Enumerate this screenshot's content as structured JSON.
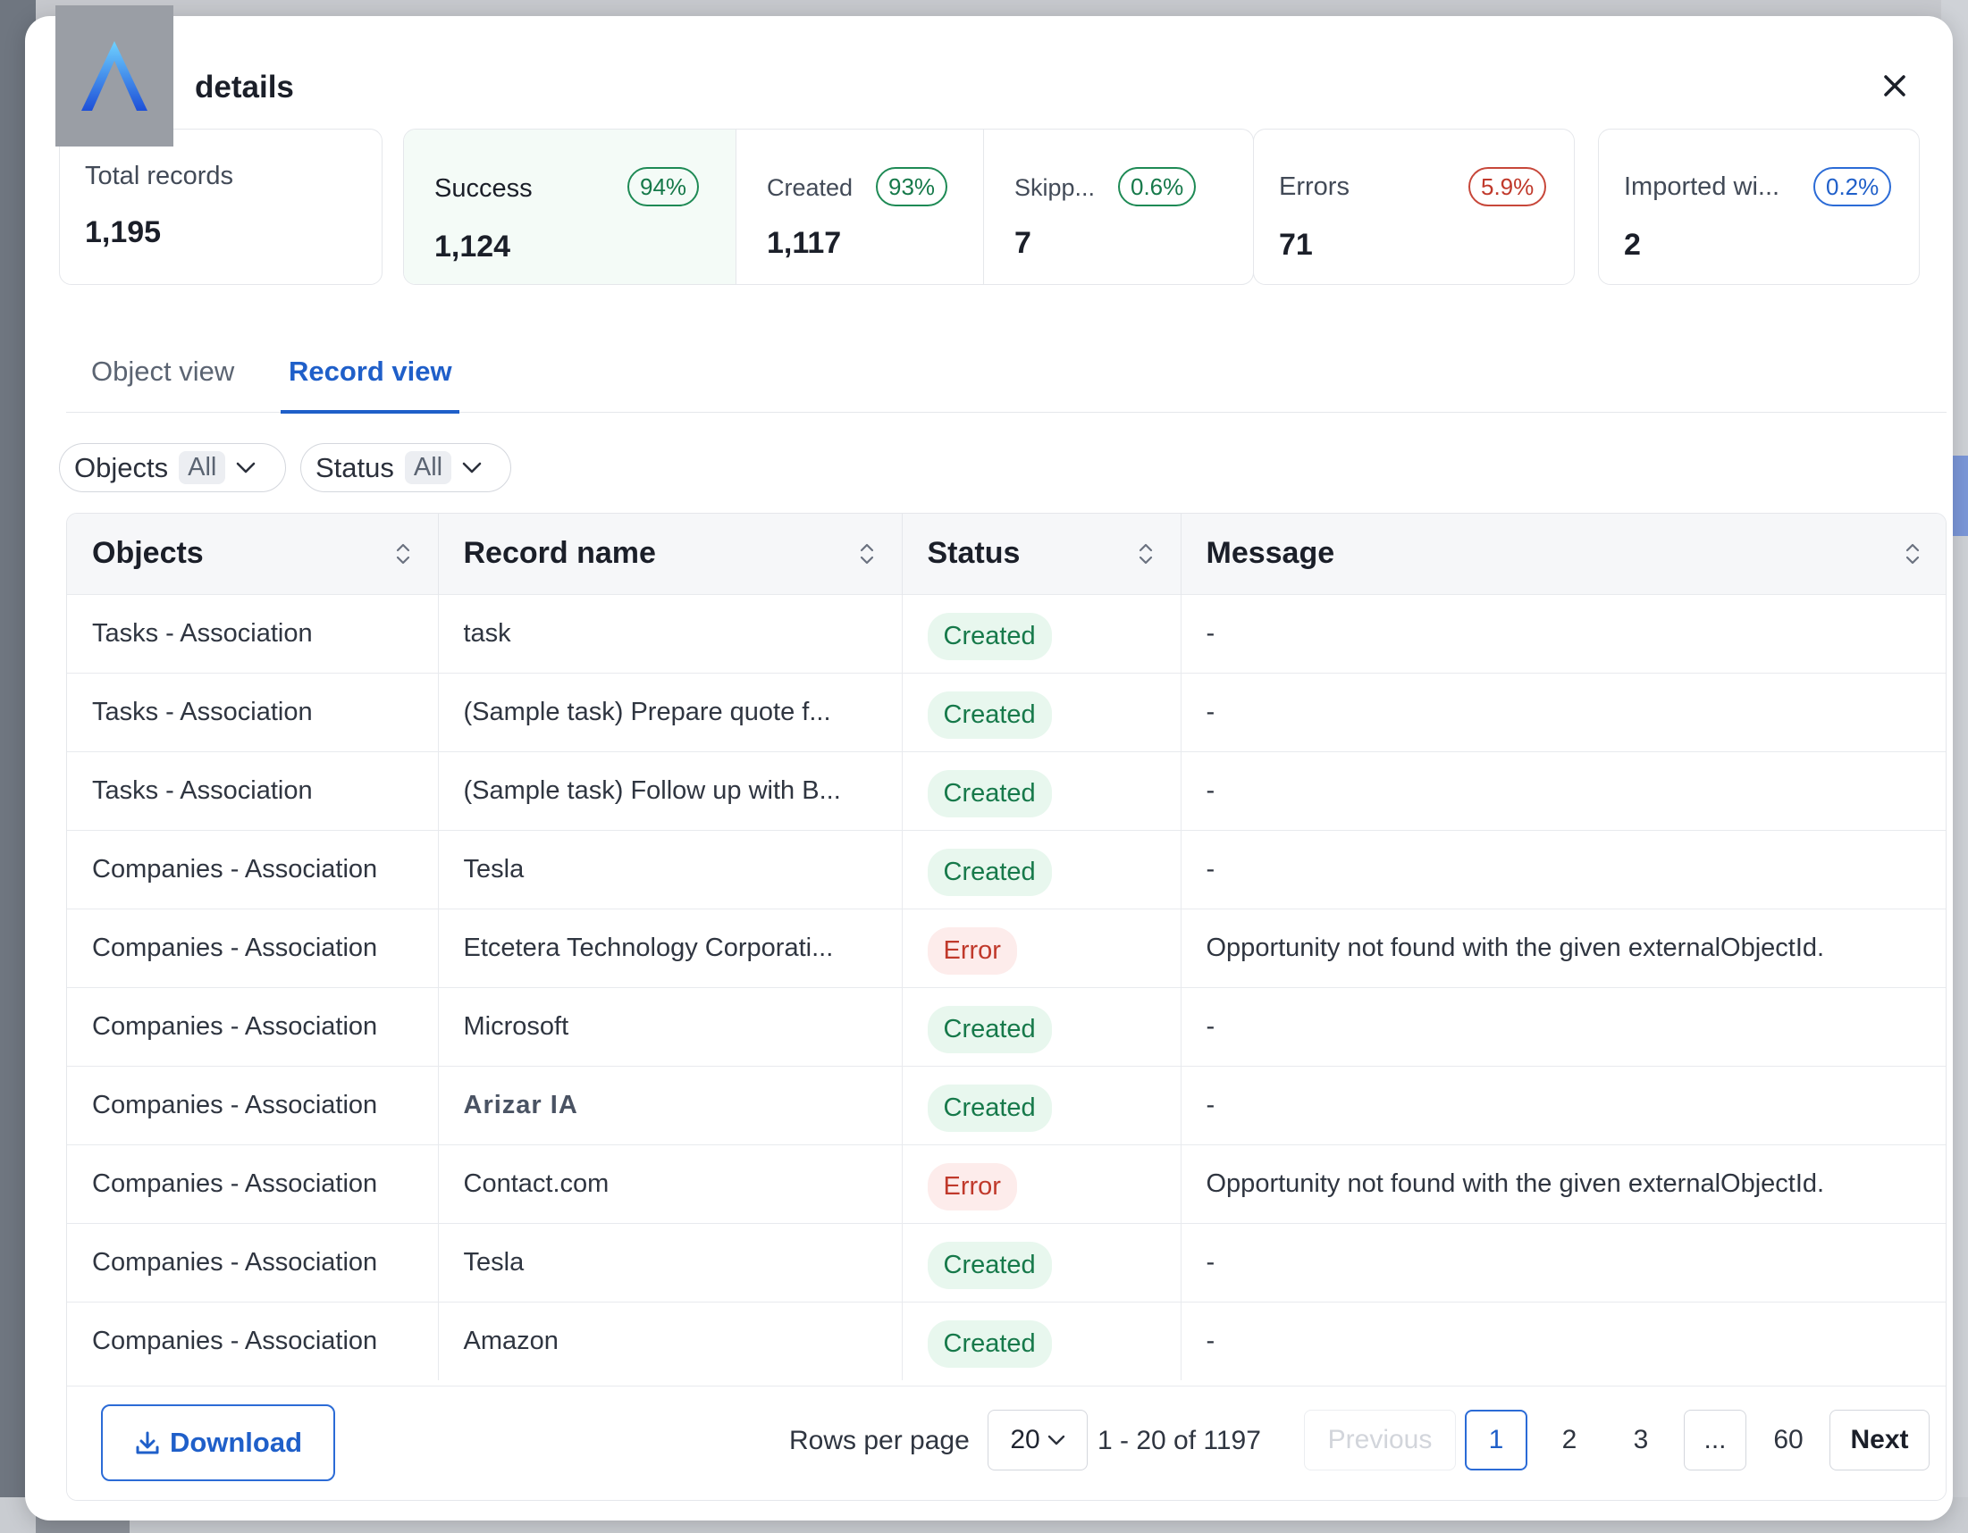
{
  "modal": {
    "title": "details"
  },
  "stats": {
    "total": {
      "label": "Total records",
      "value": "1,195"
    },
    "success": {
      "label": "Success",
      "pct": "94%",
      "value": "1,124"
    },
    "created": {
      "label": "Created",
      "pct": "93%",
      "value": "1,117"
    },
    "skipped": {
      "label": "Skipp...",
      "pct": "0.6%",
      "value": "7"
    },
    "errors": {
      "label": "Errors",
      "pct": "5.9%",
      "value": "71"
    },
    "imported": {
      "label": "Imported wi...",
      "pct": "0.2%",
      "value": "2"
    }
  },
  "tabs": [
    {
      "label": "Object view"
    },
    {
      "label": "Record view"
    }
  ],
  "filters": [
    {
      "label": "Objects",
      "value": "All"
    },
    {
      "label": "Status",
      "value": "All"
    }
  ],
  "table": {
    "headers": [
      "Objects",
      "Record name",
      "Status",
      "Message"
    ],
    "rows": [
      {
        "object": "Tasks - Association",
        "name": "task",
        "status": "Created",
        "message": "-"
      },
      {
        "object": "Tasks - Association",
        "name": "(Sample task) Prepare quote f...",
        "status": "Created",
        "message": "-"
      },
      {
        "object": "Tasks - Association",
        "name": "(Sample task) Follow up with B...",
        "status": "Created",
        "message": "-"
      },
      {
        "object": "Companies - Association",
        "name": "Tesla",
        "status": "Created",
        "message": "-"
      },
      {
        "object": "Companies - Association",
        "name": "Etcetera Technology Corporati...",
        "status": "Error",
        "message": "Opportunity not found with the given externalObjectId."
      },
      {
        "object": "Companies - Association",
        "name": "Microsoft",
        "status": "Created",
        "message": "-"
      },
      {
        "object": "Companies - Association",
        "name": "Arizar IA",
        "status": "Created",
        "message": "-"
      },
      {
        "object": "Companies - Association",
        "name": "Contact.com",
        "status": "Error",
        "message": "Opportunity not found with the given externalObjectId."
      },
      {
        "object": "Companies - Association",
        "name": "Tesla",
        "status": "Created",
        "message": "-"
      },
      {
        "object": "Companies - Association",
        "name": "Amazon",
        "status": "Created",
        "message": "-"
      }
    ]
  },
  "footer": {
    "download": "Download",
    "rows_per_page_label": "Rows per page",
    "rows_per_page": "20",
    "range": "1 - 20 of 1197",
    "prev": "Previous",
    "pages": [
      "1",
      "2",
      "3",
      "...",
      "60"
    ],
    "next": "Next"
  },
  "colors": {
    "accent": "#1f5fc9",
    "success": "#16794a",
    "error": "#c0392b"
  }
}
